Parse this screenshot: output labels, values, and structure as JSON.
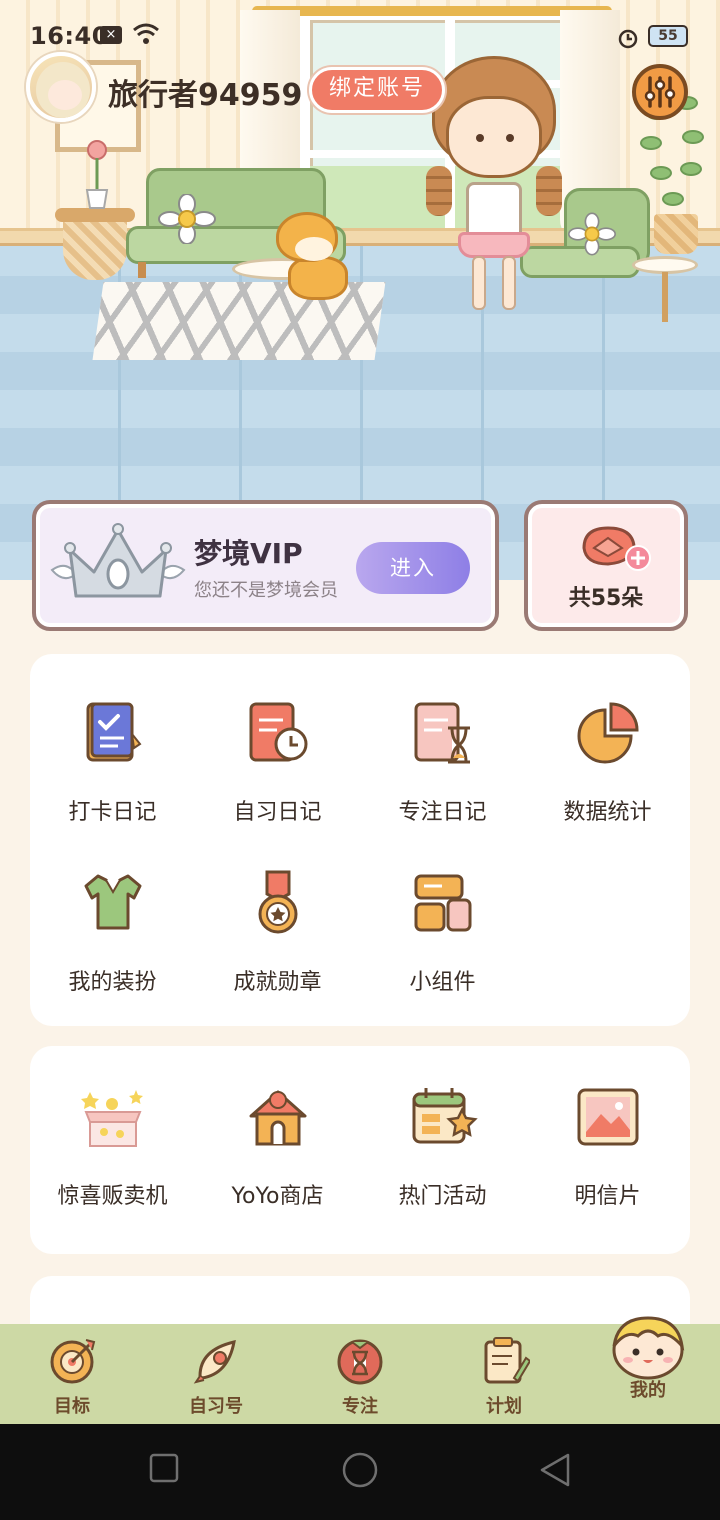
{
  "status_bar": {
    "time": "16:40",
    "notification_badge": "×",
    "battery_level": "55"
  },
  "profile": {
    "username": "旅行者94959",
    "bind_account_label": "绑定账号"
  },
  "vip": {
    "title": "梦境VIP",
    "subtitle": "您还不是梦境会员",
    "enter_label": "进入"
  },
  "flowers": {
    "count_label": "共55朵"
  },
  "menu_panel_1": [
    {
      "label": "打卡日记",
      "icon": "checkin-diary-icon"
    },
    {
      "label": "自习日记",
      "icon": "study-diary-icon"
    },
    {
      "label": "专注日记",
      "icon": "focus-diary-icon"
    },
    {
      "label": "数据统计",
      "icon": "statistics-pie-icon"
    },
    {
      "label": "我的装扮",
      "icon": "outfit-icon"
    },
    {
      "label": "成就勋章",
      "icon": "medal-icon"
    },
    {
      "label": "小组件",
      "icon": "widget-icon"
    }
  ],
  "menu_panel_2": [
    {
      "label": "惊喜贩卖机",
      "icon": "surprise-vending-icon"
    },
    {
      "label": "YoYo商店",
      "icon": "shop-icon"
    },
    {
      "label": "热门活动",
      "icon": "event-calendar-icon"
    },
    {
      "label": "明信片",
      "icon": "postcard-icon"
    }
  ],
  "tabs": [
    {
      "label": "目标",
      "icon": "target-icon"
    },
    {
      "label": "自习号",
      "icon": "rocket-icon"
    },
    {
      "label": "专注",
      "icon": "tomato-timer-icon"
    },
    {
      "label": "计划",
      "icon": "clipboard-icon"
    },
    {
      "label": "我的",
      "icon": "profile-face-icon",
      "active": true
    }
  ],
  "colors": {
    "accent_coral": "#f07b66",
    "vip_purple": "#8e7fe6",
    "tabbar_green": "#cdd9a5",
    "background_cream": "#fbf3e8"
  }
}
